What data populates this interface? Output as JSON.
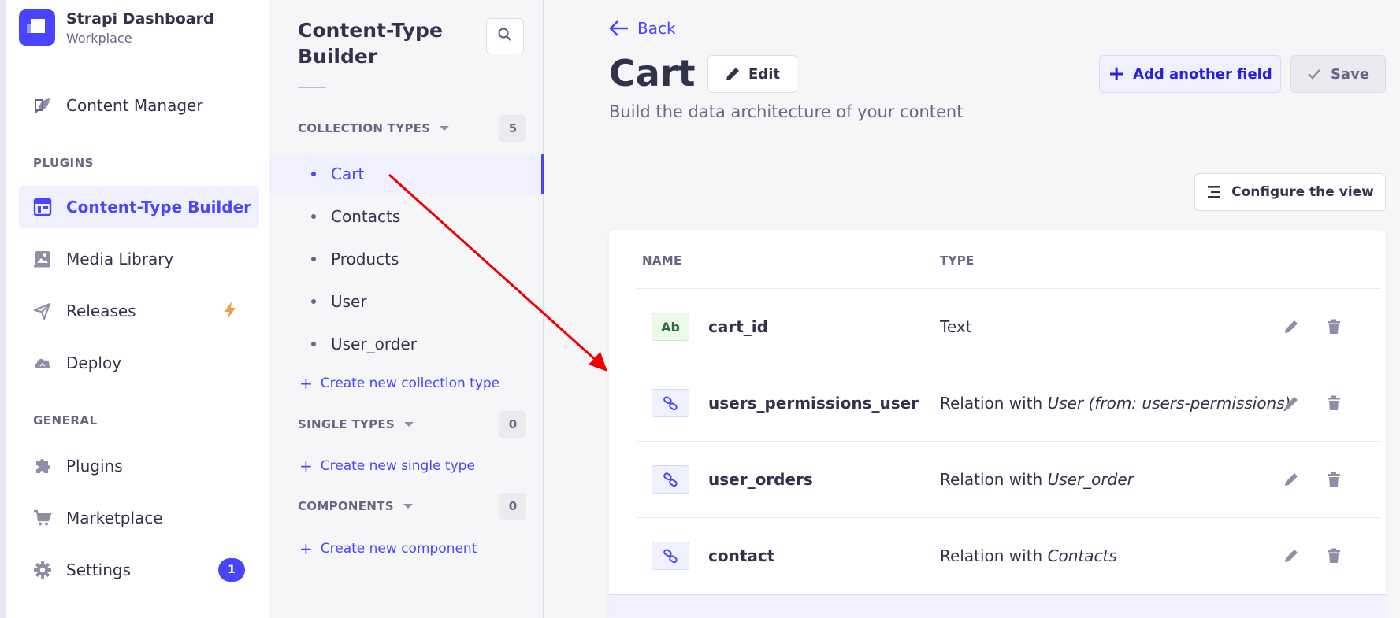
{
  "brand": {
    "title": "Strapi Dashboard",
    "subtitle": "Workplace"
  },
  "main_nav": {
    "content_manager": "Content Manager",
    "plugins_section": "PLUGINS",
    "content_type_builder": "Content-Type Builder",
    "media_library": "Media Library",
    "releases": "Releases",
    "deploy": "Deploy",
    "general_section": "GENERAL",
    "plugins": "Plugins",
    "marketplace": "Marketplace",
    "settings": "Settings",
    "settings_badge": "1"
  },
  "sub_nav": {
    "title_line1": "Content-Type",
    "title_line2": "Builder",
    "collection_types_label": "COLLECTION TYPES",
    "collection_types_count": "5",
    "collection_types": [
      "Cart",
      "Contacts",
      "Products",
      "User",
      "User_order"
    ],
    "create_collection": "Create new collection type",
    "single_types_label": "SINGLE TYPES",
    "single_types_count": "0",
    "create_single": "Create new single type",
    "components_label": "COMPONENTS",
    "components_count": "0",
    "create_component": "Create new component"
  },
  "header": {
    "back": "Back",
    "title": "Cart",
    "edit": "Edit",
    "subtitle": "Build the data architecture of your content",
    "add_field": "Add another field",
    "save": "Save",
    "configure_view": "Configure the view"
  },
  "table": {
    "col_name": "NAME",
    "col_type": "TYPE",
    "rows": [
      {
        "badge": "Ab",
        "name": "cart_id",
        "type_text": "Text",
        "type_target": ""
      },
      {
        "badge": "",
        "name": "users_permissions_user",
        "type_text": "Relation with ",
        "type_target": "User (from: users-permissions)"
      },
      {
        "badge": "",
        "name": "user_orders",
        "type_text": "Relation with ",
        "type_target": "User_order"
      },
      {
        "badge": "",
        "name": "contact",
        "type_text": "Relation with ",
        "type_target": "Contacts"
      }
    ]
  },
  "colors": {
    "accent": "#4945ff",
    "annotation_arrow": "#ee0000"
  }
}
